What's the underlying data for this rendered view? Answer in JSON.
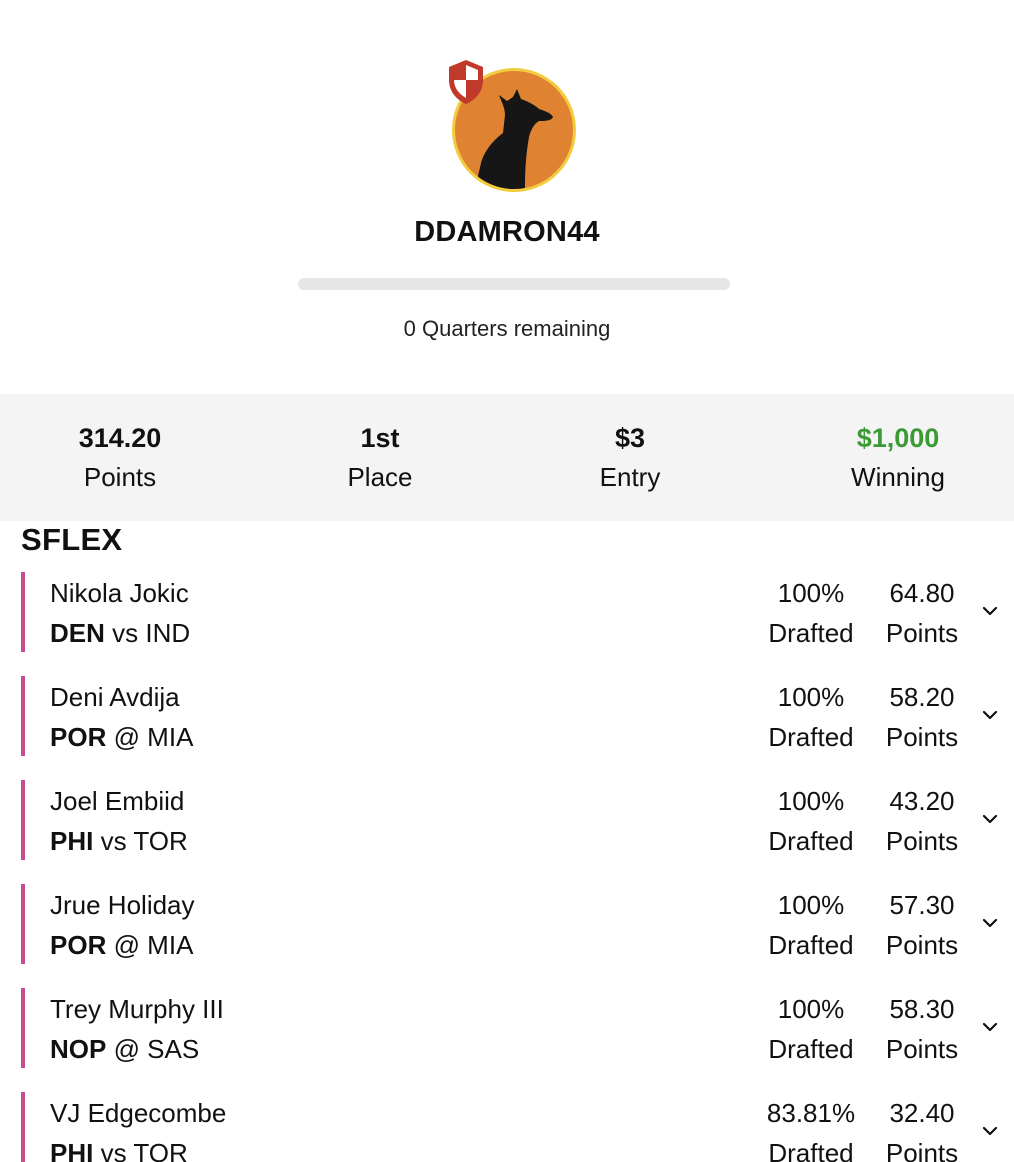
{
  "profile": {
    "username": "DDAMRON44",
    "quarters_remaining": "0 Quarters remaining",
    "progress_fraction": 0
  },
  "stats": {
    "points_value": "314.20",
    "points_label": "Points",
    "place_value": "1st",
    "place_label": "Place",
    "entry_value": "$3",
    "entry_label": "Entry",
    "winning_value": "$1,000",
    "winning_label": "Winning"
  },
  "section": {
    "title": "SFLEX"
  },
  "players": [
    {
      "name": "Nikola Jokic",
      "team": "DEN",
      "matchup": " vs IND",
      "drafted_pct": "100%",
      "drafted_label": "Drafted",
      "points": "64.80",
      "points_label": "Points"
    },
    {
      "name": "Deni Avdija",
      "team": "POR",
      "matchup": " @ MIA",
      "drafted_pct": "100%",
      "drafted_label": "Drafted",
      "points": "58.20",
      "points_label": "Points"
    },
    {
      "name": "Joel Embiid",
      "team": "PHI",
      "matchup": " vs TOR",
      "drafted_pct": "100%",
      "drafted_label": "Drafted",
      "points": "43.20",
      "points_label": "Points"
    },
    {
      "name": "Jrue Holiday",
      "team": "POR",
      "matchup": " @ MIA",
      "drafted_pct": "100%",
      "drafted_label": "Drafted",
      "points": "57.30",
      "points_label": "Points"
    },
    {
      "name": "Trey Murphy III",
      "team": "NOP",
      "matchup": " @ SAS",
      "drafted_pct": "100%",
      "drafted_label": "Drafted",
      "points": "58.30",
      "points_label": "Points"
    },
    {
      "name": "VJ Edgecombe",
      "team": "PHI",
      "matchup": " vs TOR",
      "drafted_pct": "83.81%",
      "drafted_label": "Drafted",
      "points": "32.40",
      "points_label": "Points"
    }
  ],
  "colors": {
    "accent_bar": "#c4508c",
    "winning_green": "#3b9a34",
    "avatar_bg": "#df8332",
    "avatar_border": "#f2cc3e",
    "shield_red": "#c0392b"
  },
  "icons": {
    "avatar": "dog-silhouette-icon",
    "badge": "shield-icon",
    "expand": "chevron-down-icon"
  }
}
